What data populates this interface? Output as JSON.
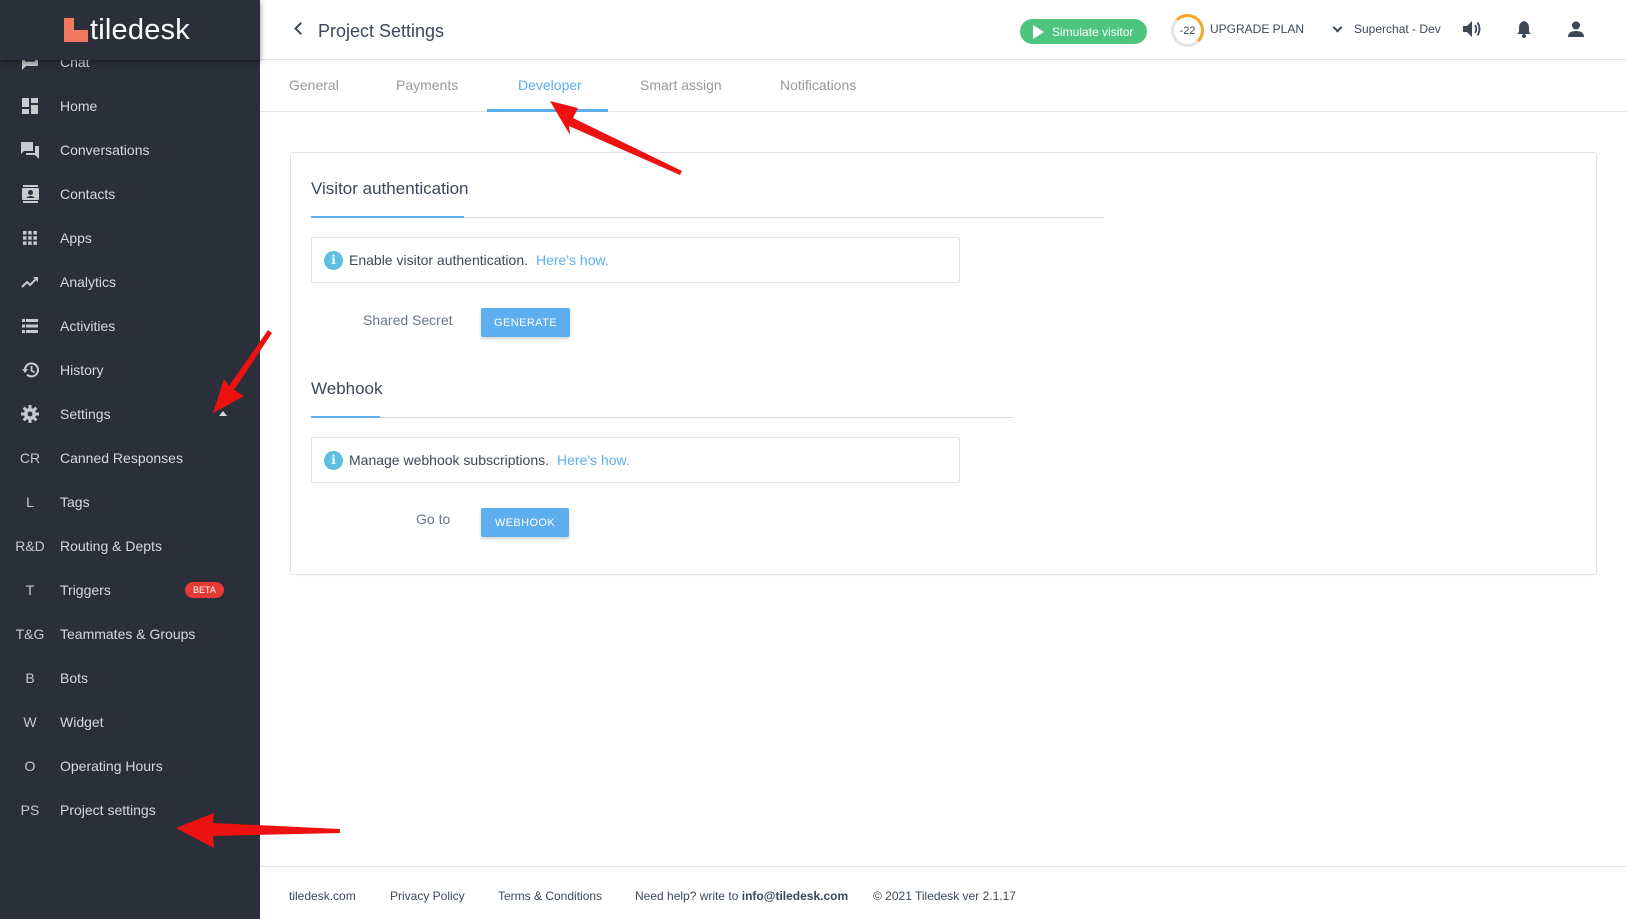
{
  "brand": {
    "name": "tiledesk",
    "accent": "#f27b5f"
  },
  "sidebar": {
    "items": [
      {
        "label": "Chat",
        "icon": "chat-icon"
      },
      {
        "label": "Home",
        "icon": "dashboard-icon"
      },
      {
        "label": "Conversations",
        "icon": "forum-icon"
      },
      {
        "label": "Contacts",
        "icon": "contact-card-icon"
      },
      {
        "label": "Apps",
        "icon": "apps-grid-icon"
      },
      {
        "label": "Analytics",
        "icon": "trending-up-icon"
      },
      {
        "label": "Activities",
        "icon": "list-icon"
      },
      {
        "label": "History",
        "icon": "history-icon"
      },
      {
        "label": "Settings",
        "icon": "gear-icon"
      }
    ],
    "settings_items": [
      {
        "abbr": "CR",
        "label": "Canned Responses"
      },
      {
        "abbr": "L",
        "label": "Tags"
      },
      {
        "abbr": "R&D",
        "label": "Routing & Depts"
      },
      {
        "abbr": "T",
        "label": "Triggers",
        "badge": "BETA"
      },
      {
        "abbr": "T&G",
        "label": "Teammates & Groups"
      },
      {
        "abbr": "B",
        "label": "Bots"
      },
      {
        "abbr": "W",
        "label": "Widget"
      },
      {
        "abbr": "O",
        "label": "Operating Hours"
      },
      {
        "abbr": "PS",
        "label": "Project settings"
      }
    ]
  },
  "header": {
    "title": "Project Settings",
    "simulate_label": "Simulate visitor",
    "gauge_value": "-22",
    "upgrade_label": "UPGRADE PLAN",
    "project_name": "Superchat - Dev"
  },
  "tabs": [
    {
      "label": "General"
    },
    {
      "label": "Payments"
    },
    {
      "label": "Developer",
      "active": true
    },
    {
      "label": "Smart assign"
    },
    {
      "label": "Notifications"
    }
  ],
  "visitor_auth": {
    "title": "Visitor authentication",
    "info_text": "Enable visitor authentication.",
    "info_link": "Here's how.",
    "field_label": "Shared Secret",
    "button_label": "GENERATE"
  },
  "webhook": {
    "title": "Webhook",
    "info_text": "Manage webhook subscriptions.",
    "info_link": "Here's how.",
    "field_label": "Go to",
    "button_label": "WEBHOOK"
  },
  "footer": {
    "site": "tiledesk.com",
    "privacy": "Privacy Policy",
    "terms": "Terms & Conditions",
    "help_prefix": "Need help? write to",
    "help_email": "info@tiledesk.com",
    "copyright": "© 2021 Tiledesk ver 2.1.17"
  },
  "colors": {
    "sidebar_bg": "#2b2f3a",
    "accent_blue": "#5caeee",
    "simulate_green": "#4dc57c",
    "beta_red": "#e53935",
    "annotation_arrow": "#ee1111"
  }
}
